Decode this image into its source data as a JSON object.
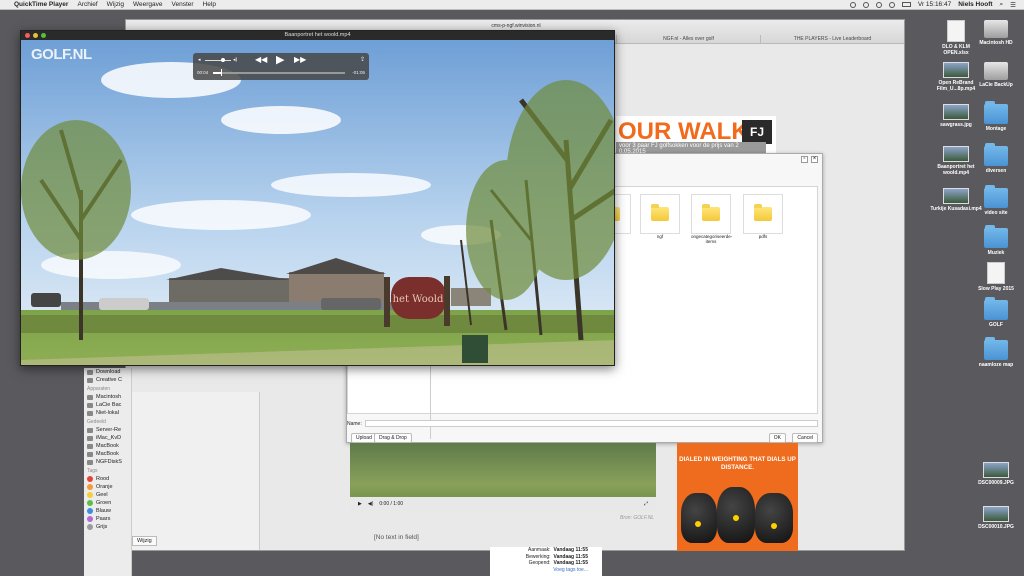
{
  "menubar": {
    "apple": "",
    "app": "QuickTime Player",
    "items": [
      "Archief",
      "Wijzig",
      "Weergave",
      "Venster",
      "Help"
    ],
    "clock": "Vr 15:16:47",
    "user": "Niels Hooft"
  },
  "desktop": {
    "icons": [
      {
        "label": "DLO & KLM OPEN.xlsx",
        "kind": "doc"
      },
      {
        "label": "Macintosh HD",
        "kind": "drive"
      },
      {
        "label": "Open ReBrand Film_U...8p.mp4",
        "kind": "thumb"
      },
      {
        "label": "LaCie BackUp",
        "kind": "drive"
      },
      {
        "label": "sawgrass.jpg",
        "kind": "thumb"
      },
      {
        "label": "Montage",
        "kind": "folder"
      },
      {
        "label": "Baanportret het woold.mp4",
        "kind": "thumb"
      },
      {
        "label": "diversen",
        "kind": "folder"
      },
      {
        "label": "Turkije Kusadasi.mp4",
        "kind": "thumb"
      },
      {
        "label": "video site",
        "kind": "folder"
      },
      {
        "label": "Muziek",
        "kind": "folder"
      },
      {
        "label": "Slow Play 2015",
        "kind": "doc"
      },
      {
        "label": "GOLF",
        "kind": "folder"
      },
      {
        "label": "naamloze map",
        "kind": "folder"
      },
      {
        "label": "DSC00009.JPG",
        "kind": "thumb"
      },
      {
        "label": "DSC00010.JPG",
        "kind": "thumb"
      }
    ]
  },
  "browser": {
    "url": "cms-p-ngf.winvision.nl",
    "tabs": [
      "NGF.nl - Alles over golf",
      "THE PLAYERS - Live Leaderboard"
    ],
    "banner": {
      "title": "OUR WALK",
      "brand": "FJ",
      "subtitle": "voor 3 paar FJ golfsokken voor de prijs van 2",
      "subtitle2": "0.05.2015"
    },
    "edit_button": "Wijzig",
    "video_source": "Bron: GOLF.NL",
    "video_time": "0:00 / 1:00",
    "placeholder_text": "[No text in field]",
    "ad_text": "DIALED IN WEIGHTING THAT DIALS UP DISTANCE."
  },
  "finder_sidebar": {
    "favorites": [
      "Download",
      "Creative C"
    ],
    "devices_title": "Apparaten",
    "devices": [
      "Macintosh",
      "LaCie Bac",
      "Niet-lokal"
    ],
    "shared_title": "Gedeeld",
    "shared": [
      "Server-Re",
      "iMac_KvD",
      "MacBook",
      "MacBook",
      "NGFDiskS"
    ],
    "tags_title": "Tags",
    "tags": [
      {
        "label": "Rood",
        "color": "#e4453a"
      },
      {
        "label": "Oranje",
        "color": "#f29b38"
      },
      {
        "label": "Geel",
        "color": "#f3cf3a"
      },
      {
        "label": "Groen",
        "color": "#5bbf45"
      },
      {
        "label": "Blauw",
        "color": "#3d8de0"
      },
      {
        "label": "Paars",
        "color": "#b36ad6"
      },
      {
        "label": "Grijs",
        "color": "#9a9a9a"
      }
    ]
  },
  "dialog": {
    "folders": [
      "",
      "ngf",
      "ongecategoriseerde-items",
      "pdfs"
    ],
    "name_label": "Name:",
    "upload": "Upload",
    "dragdrop": "Drag & Drop",
    "ok": "OK",
    "cancel": "Cancel"
  },
  "meta": {
    "rows": [
      {
        "k": "Aanmaak:",
        "v": "Vandaag 11:55"
      },
      {
        "k": "Bewerking:",
        "v": "Vandaag 11:55"
      },
      {
        "k": "Geopend:",
        "v": "Vandaag 11:55"
      }
    ],
    "link": "Voeg tags toe..."
  },
  "quicktime": {
    "title": "Baanportret het woold.mp4",
    "logo": "GOLF.NL",
    "elapsed": "00:04",
    "remaining": "-01:05",
    "progress": 0.06,
    "volume": 0.7,
    "sign_text": "het Woold",
    "colors": {
      "close": "#fc5b57",
      "min": "#e5bf3c",
      "max": "#57c038"
    }
  }
}
